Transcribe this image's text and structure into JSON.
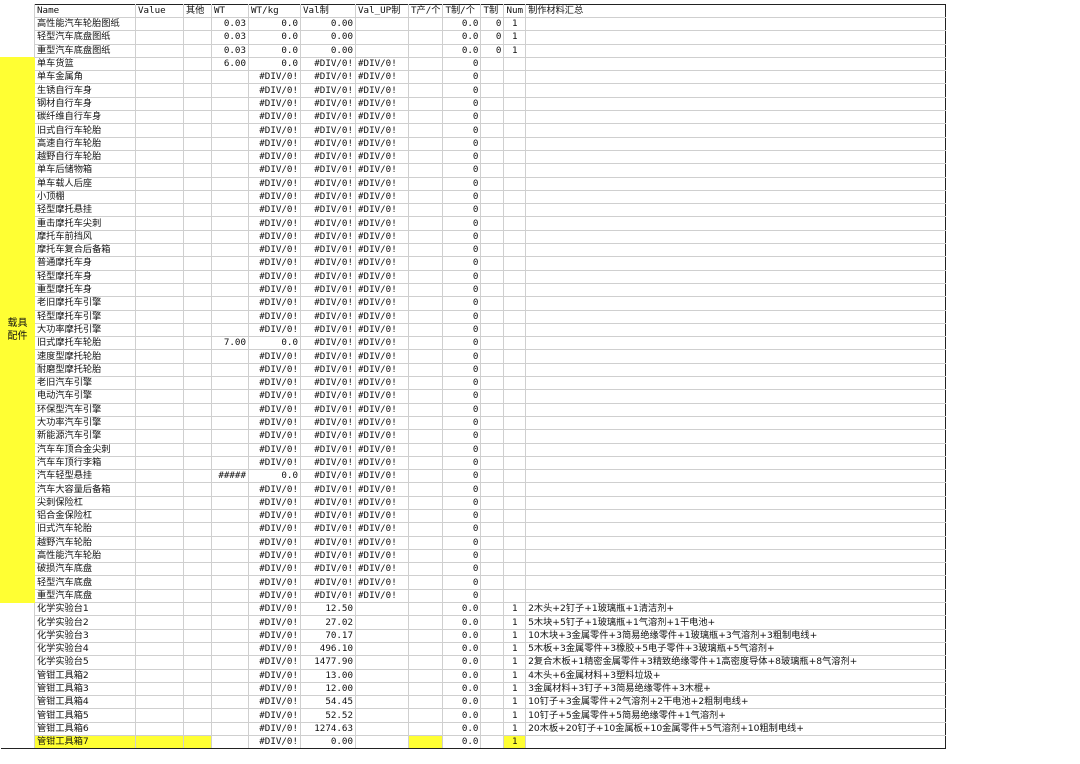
{
  "headers": [
    "Name",
    "Value",
    "其他",
    "WT",
    "WT/kg",
    "Val制",
    "Val_UP制",
    "T产/个",
    "T制/个",
    "T制",
    "Num",
    "制作材料汇总"
  ],
  "group_label": "载具配件",
  "rows": [
    {
      "name": "高性能汽车轮胎图纸",
      "value": "",
      "other": "",
      "wt": "0.03",
      "wtkg": "0.0",
      "val": "0.00",
      "valup": "",
      "tp": "",
      "tz": "0.0",
      "t": "0",
      "num": "1",
      "sum": ""
    },
    {
      "name": "轻型汽车底盘图纸",
      "value": "",
      "other": "",
      "wt": "0.03",
      "wtkg": "0.0",
      "val": "0.00",
      "valup": "",
      "tp": "",
      "tz": "0.0",
      "t": "0",
      "num": "1",
      "sum": ""
    },
    {
      "name": "重型汽车底盘图纸",
      "value": "",
      "other": "",
      "wt": "0.03",
      "wtkg": "0.0",
      "val": "0.00",
      "valup": "",
      "tp": "",
      "tz": "0.0",
      "t": "0",
      "num": "1",
      "sum": ""
    },
    {
      "name": "单车货篮",
      "value": "",
      "other": "",
      "wt": "6.00",
      "wtkg": "0.0",
      "val": "#DIV/0!",
      "valup": "#DIV/0!",
      "tp": "",
      "tz": "0",
      "t": "",
      "num": "",
      "sum": ""
    },
    {
      "name": "单车金属角",
      "value": "",
      "other": "",
      "wt": "",
      "wtkg": "#DIV/0!",
      "val": "#DIV/0!",
      "valup": "#DIV/0!",
      "tp": "",
      "tz": "0",
      "t": "",
      "num": "",
      "sum": ""
    },
    {
      "name": "生锈自行车身",
      "value": "",
      "other": "",
      "wt": "",
      "wtkg": "#DIV/0!",
      "val": "#DIV/0!",
      "valup": "#DIV/0!",
      "tp": "",
      "tz": "0",
      "t": "",
      "num": "",
      "sum": ""
    },
    {
      "name": "钢材自行车身",
      "value": "",
      "other": "",
      "wt": "",
      "wtkg": "#DIV/0!",
      "val": "#DIV/0!",
      "valup": "#DIV/0!",
      "tp": "",
      "tz": "0",
      "t": "",
      "num": "",
      "sum": ""
    },
    {
      "name": "碳纤维自行车身",
      "value": "",
      "other": "",
      "wt": "",
      "wtkg": "#DIV/0!",
      "val": "#DIV/0!",
      "valup": "#DIV/0!",
      "tp": "",
      "tz": "0",
      "t": "",
      "num": "",
      "sum": ""
    },
    {
      "name": "旧式自行车轮胎",
      "value": "",
      "other": "",
      "wt": "",
      "wtkg": "#DIV/0!",
      "val": "#DIV/0!",
      "valup": "#DIV/0!",
      "tp": "",
      "tz": "0",
      "t": "",
      "num": "",
      "sum": ""
    },
    {
      "name": "高速自行车轮胎",
      "value": "",
      "other": "",
      "wt": "",
      "wtkg": "#DIV/0!",
      "val": "#DIV/0!",
      "valup": "#DIV/0!",
      "tp": "",
      "tz": "0",
      "t": "",
      "num": "",
      "sum": ""
    },
    {
      "name": "越野自行车轮胎",
      "value": "",
      "other": "",
      "wt": "",
      "wtkg": "#DIV/0!",
      "val": "#DIV/0!",
      "valup": "#DIV/0!",
      "tp": "",
      "tz": "0",
      "t": "",
      "num": "",
      "sum": ""
    },
    {
      "name": "单车后储物箱",
      "value": "",
      "other": "",
      "wt": "",
      "wtkg": "#DIV/0!",
      "val": "#DIV/0!",
      "valup": "#DIV/0!",
      "tp": "",
      "tz": "0",
      "t": "",
      "num": "",
      "sum": ""
    },
    {
      "name": "单车载人后座",
      "value": "",
      "other": "",
      "wt": "",
      "wtkg": "#DIV/0!",
      "val": "#DIV/0!",
      "valup": "#DIV/0!",
      "tp": "",
      "tz": "0",
      "t": "",
      "num": "",
      "sum": ""
    },
    {
      "name": "小顶棚",
      "value": "",
      "other": "",
      "wt": "",
      "wtkg": "#DIV/0!",
      "val": "#DIV/0!",
      "valup": "#DIV/0!",
      "tp": "",
      "tz": "0",
      "t": "",
      "num": "",
      "sum": ""
    },
    {
      "name": "轻型摩托悬挂",
      "value": "",
      "other": "",
      "wt": "",
      "wtkg": "#DIV/0!",
      "val": "#DIV/0!",
      "valup": "#DIV/0!",
      "tp": "",
      "tz": "0",
      "t": "",
      "num": "",
      "sum": ""
    },
    {
      "name": "重击摩托车尖刺",
      "value": "",
      "other": "",
      "wt": "",
      "wtkg": "#DIV/0!",
      "val": "#DIV/0!",
      "valup": "#DIV/0!",
      "tp": "",
      "tz": "0",
      "t": "",
      "num": "",
      "sum": ""
    },
    {
      "name": "摩托车前挡风",
      "value": "",
      "other": "",
      "wt": "",
      "wtkg": "#DIV/0!",
      "val": "#DIV/0!",
      "valup": "#DIV/0!",
      "tp": "",
      "tz": "0",
      "t": "",
      "num": "",
      "sum": ""
    },
    {
      "name": "摩托车复合后备箱",
      "value": "",
      "other": "",
      "wt": "",
      "wtkg": "#DIV/0!",
      "val": "#DIV/0!",
      "valup": "#DIV/0!",
      "tp": "",
      "tz": "0",
      "t": "",
      "num": "",
      "sum": ""
    },
    {
      "name": "普通摩托车身",
      "value": "",
      "other": "",
      "wt": "",
      "wtkg": "#DIV/0!",
      "val": "#DIV/0!",
      "valup": "#DIV/0!",
      "tp": "",
      "tz": "0",
      "t": "",
      "num": "",
      "sum": ""
    },
    {
      "name": "轻型摩托车身",
      "value": "",
      "other": "",
      "wt": "",
      "wtkg": "#DIV/0!",
      "val": "#DIV/0!",
      "valup": "#DIV/0!",
      "tp": "",
      "tz": "0",
      "t": "",
      "num": "",
      "sum": ""
    },
    {
      "name": "重型摩托车身",
      "value": "",
      "other": "",
      "wt": "",
      "wtkg": "#DIV/0!",
      "val": "#DIV/0!",
      "valup": "#DIV/0!",
      "tp": "",
      "tz": "0",
      "t": "",
      "num": "",
      "sum": ""
    },
    {
      "name": "老旧摩托车引擎",
      "value": "",
      "other": "",
      "wt": "",
      "wtkg": "#DIV/0!",
      "val": "#DIV/0!",
      "valup": "#DIV/0!",
      "tp": "",
      "tz": "0",
      "t": "",
      "num": "",
      "sum": ""
    },
    {
      "name": "轻型摩托车引擎",
      "value": "",
      "other": "",
      "wt": "",
      "wtkg": "#DIV/0!",
      "val": "#DIV/0!",
      "valup": "#DIV/0!",
      "tp": "",
      "tz": "0",
      "t": "",
      "num": "",
      "sum": ""
    },
    {
      "name": "大功率摩托引擎",
      "value": "",
      "other": "",
      "wt": "",
      "wtkg": "#DIV/0!",
      "val": "#DIV/0!",
      "valup": "#DIV/0!",
      "tp": "",
      "tz": "0",
      "t": "",
      "num": "",
      "sum": ""
    },
    {
      "name": "旧式摩托车轮胎",
      "value": "",
      "other": "",
      "wt": "7.00",
      "wtkg": "0.0",
      "val": "#DIV/0!",
      "valup": "#DIV/0!",
      "tp": "",
      "tz": "0",
      "t": "",
      "num": "",
      "sum": ""
    },
    {
      "name": "速度型摩托轮胎",
      "value": "",
      "other": "",
      "wt": "",
      "wtkg": "#DIV/0!",
      "val": "#DIV/0!",
      "valup": "#DIV/0!",
      "tp": "",
      "tz": "0",
      "t": "",
      "num": "",
      "sum": ""
    },
    {
      "name": "耐磨型摩托轮胎",
      "value": "",
      "other": "",
      "wt": "",
      "wtkg": "#DIV/0!",
      "val": "#DIV/0!",
      "valup": "#DIV/0!",
      "tp": "",
      "tz": "0",
      "t": "",
      "num": "",
      "sum": ""
    },
    {
      "name": "老旧汽车引擎",
      "value": "",
      "other": "",
      "wt": "",
      "wtkg": "#DIV/0!",
      "val": "#DIV/0!",
      "valup": "#DIV/0!",
      "tp": "",
      "tz": "0",
      "t": "",
      "num": "",
      "sum": ""
    },
    {
      "name": "电动汽车引擎",
      "value": "",
      "other": "",
      "wt": "",
      "wtkg": "#DIV/0!",
      "val": "#DIV/0!",
      "valup": "#DIV/0!",
      "tp": "",
      "tz": "0",
      "t": "",
      "num": "",
      "sum": ""
    },
    {
      "name": "环保型汽车引擎",
      "value": "",
      "other": "",
      "wt": "",
      "wtkg": "#DIV/0!",
      "val": "#DIV/0!",
      "valup": "#DIV/0!",
      "tp": "",
      "tz": "0",
      "t": "",
      "num": "",
      "sum": ""
    },
    {
      "name": "大功率汽车引擎",
      "value": "",
      "other": "",
      "wt": "",
      "wtkg": "#DIV/0!",
      "val": "#DIV/0!",
      "valup": "#DIV/0!",
      "tp": "",
      "tz": "0",
      "t": "",
      "num": "",
      "sum": ""
    },
    {
      "name": "新能源汽车引擎",
      "value": "",
      "other": "",
      "wt": "",
      "wtkg": "#DIV/0!",
      "val": "#DIV/0!",
      "valup": "#DIV/0!",
      "tp": "",
      "tz": "0",
      "t": "",
      "num": "",
      "sum": ""
    },
    {
      "name": "汽车车顶合金尖刺",
      "value": "",
      "other": "",
      "wt": "",
      "wtkg": "#DIV/0!",
      "val": "#DIV/0!",
      "valup": "#DIV/0!",
      "tp": "",
      "tz": "0",
      "t": "",
      "num": "",
      "sum": ""
    },
    {
      "name": "汽车车顶行李箱",
      "value": "",
      "other": "",
      "wt": "",
      "wtkg": "#DIV/0!",
      "val": "#DIV/0!",
      "valup": "#DIV/0!",
      "tp": "",
      "tz": "0",
      "t": "",
      "num": "",
      "sum": ""
    },
    {
      "name": "汽车轻型悬挂",
      "value": "",
      "other": "",
      "wt": "#####",
      "wtkg": "0.0",
      "val": "#DIV/0!",
      "valup": "#DIV/0!",
      "tp": "",
      "tz": "0",
      "t": "",
      "num": "",
      "sum": ""
    },
    {
      "name": "汽车大容量后备箱",
      "value": "",
      "other": "",
      "wt": "",
      "wtkg": "#DIV/0!",
      "val": "#DIV/0!",
      "valup": "#DIV/0!",
      "tp": "",
      "tz": "0",
      "t": "",
      "num": "",
      "sum": ""
    },
    {
      "name": "尖刺保险杠",
      "value": "",
      "other": "",
      "wt": "",
      "wtkg": "#DIV/0!",
      "val": "#DIV/0!",
      "valup": "#DIV/0!",
      "tp": "",
      "tz": "0",
      "t": "",
      "num": "",
      "sum": ""
    },
    {
      "name": "铝合金保险杠",
      "value": "",
      "other": "",
      "wt": "",
      "wtkg": "#DIV/0!",
      "val": "#DIV/0!",
      "valup": "#DIV/0!",
      "tp": "",
      "tz": "0",
      "t": "",
      "num": "",
      "sum": ""
    },
    {
      "name": "旧式汽车轮胎",
      "value": "",
      "other": "",
      "wt": "",
      "wtkg": "#DIV/0!",
      "val": "#DIV/0!",
      "valup": "#DIV/0!",
      "tp": "",
      "tz": "0",
      "t": "",
      "num": "",
      "sum": ""
    },
    {
      "name": "越野汽车轮胎",
      "value": "",
      "other": "",
      "wt": "",
      "wtkg": "#DIV/0!",
      "val": "#DIV/0!",
      "valup": "#DIV/0!",
      "tp": "",
      "tz": "0",
      "t": "",
      "num": "",
      "sum": ""
    },
    {
      "name": "高性能汽车轮胎",
      "value": "",
      "other": "",
      "wt": "",
      "wtkg": "#DIV/0!",
      "val": "#DIV/0!",
      "valup": "#DIV/0!",
      "tp": "",
      "tz": "0",
      "t": "",
      "num": "",
      "sum": ""
    },
    {
      "name": "破损汽车底盘",
      "value": "",
      "other": "",
      "wt": "",
      "wtkg": "#DIV/0!",
      "val": "#DIV/0!",
      "valup": "#DIV/0!",
      "tp": "",
      "tz": "0",
      "t": "",
      "num": "",
      "sum": ""
    },
    {
      "name": "轻型汽车底盘",
      "value": "",
      "other": "",
      "wt": "",
      "wtkg": "#DIV/0!",
      "val": "#DIV/0!",
      "valup": "#DIV/0!",
      "tp": "",
      "tz": "0",
      "t": "",
      "num": "",
      "sum": ""
    },
    {
      "name": "重型汽车底盘",
      "value": "",
      "other": "",
      "wt": "",
      "wtkg": "#DIV/0!",
      "val": "#DIV/0!",
      "valup": "#DIV/0!",
      "tp": "",
      "tz": "0",
      "t": "",
      "num": "",
      "sum": ""
    },
    {
      "name": "化学实验台1",
      "value": "",
      "other": "",
      "wt": "",
      "wtkg": "#DIV/0!",
      "val": "12.50",
      "valup": "",
      "tp": "",
      "tz": "0.0",
      "t": "",
      "num": "1",
      "sum": "2木头+2钉子+1玻璃瓶+1清洁剂+"
    },
    {
      "name": "化学实验台2",
      "value": "",
      "other": "",
      "wt": "",
      "wtkg": "#DIV/0!",
      "val": "27.02",
      "valup": "",
      "tp": "",
      "tz": "0.0",
      "t": "",
      "num": "1",
      "sum": "5木块+5钉子+1玻璃瓶+1气溶剂+1干电池+"
    },
    {
      "name": "化学实验台3",
      "value": "",
      "other": "",
      "wt": "",
      "wtkg": "#DIV/0!",
      "val": "70.17",
      "valup": "",
      "tp": "",
      "tz": "0.0",
      "t": "",
      "num": "1",
      "sum": "10木块+3金属零件+3简易绝缘零件+1玻璃瓶+3气溶剂+3粗制电线+"
    },
    {
      "name": "化学实验台4",
      "value": "",
      "other": "",
      "wt": "",
      "wtkg": "#DIV/0!",
      "val": "496.10",
      "valup": "",
      "tp": "",
      "tz": "0.0",
      "t": "",
      "num": "1",
      "sum": "5木板+3金属零件+3橡胶+5电子零件+3玻璃瓶+5气溶剂+"
    },
    {
      "name": "化学实验台5",
      "value": "",
      "other": "",
      "wt": "",
      "wtkg": "#DIV/0!",
      "val": "1477.90",
      "valup": "",
      "tp": "",
      "tz": "0.0",
      "t": "",
      "num": "1",
      "sum": "2复合木板+1精密金属零件+3精致绝缘零件+1高密度导体+8玻璃瓶+8气溶剂+"
    },
    {
      "name": "管钳工具箱2",
      "value": "",
      "other": "",
      "wt": "",
      "wtkg": "#DIV/0!",
      "val": "13.00",
      "valup": "",
      "tp": "",
      "tz": "0.0",
      "t": "",
      "num": "1",
      "sum": "4木头+6金属材料+3塑料垃圾+"
    },
    {
      "name": "管钳工具箱3",
      "value": "",
      "other": "",
      "wt": "",
      "wtkg": "#DIV/0!",
      "val": "12.00",
      "valup": "",
      "tp": "",
      "tz": "0.0",
      "t": "",
      "num": "1",
      "sum": "3金属材料+3钉子+3简易绝缘零件+3木棍+"
    },
    {
      "name": "管钳工具箱4",
      "value": "",
      "other": "",
      "wt": "",
      "wtkg": "#DIV/0!",
      "val": "54.45",
      "valup": "",
      "tp": "",
      "tz": "0.0",
      "t": "",
      "num": "1",
      "sum": "10钉子+3金属零件+2气溶剂+2干电池+2粗制电线+"
    },
    {
      "name": "管钳工具箱5",
      "value": "",
      "other": "",
      "wt": "",
      "wtkg": "#DIV/0!",
      "val": "52.52",
      "valup": "",
      "tp": "",
      "tz": "0.0",
      "t": "",
      "num": "1",
      "sum": "10钉子+5金属零件+5简易绝缘零件+1气溶剂+"
    },
    {
      "name": "管钳工具箱6",
      "value": "",
      "other": "",
      "wt": "",
      "wtkg": "#DIV/0!",
      "val": "1274.63",
      "valup": "",
      "tp": "",
      "tz": "0.0",
      "t": "",
      "num": "1",
      "sum": "20木板+20钉子+10金属板+10金属零件+5气溶剂+10粗制电线+"
    },
    {
      "name": "管钳工具箱7",
      "value": "",
      "other": "",
      "wt": "",
      "wtkg": "#DIV/0!",
      "val": "0.00",
      "valup": "",
      "tp": "",
      "tz": "0.0",
      "t": "",
      "num": "1",
      "sum": ""
    }
  ],
  "colors": {
    "highlight": "#ffff33",
    "grid": "#cfcfcf"
  }
}
